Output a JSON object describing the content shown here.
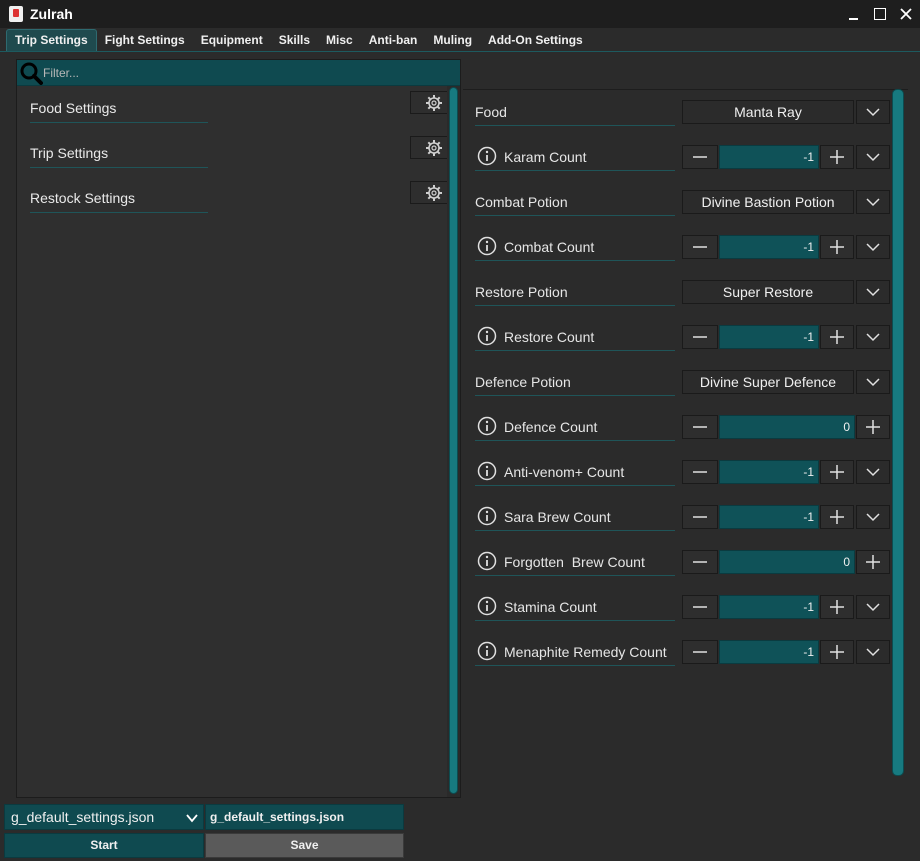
{
  "window": {
    "title": "Zulrah"
  },
  "tabs": [
    {
      "label": "Trip Settings",
      "active": true
    },
    {
      "label": "Fight Settings"
    },
    {
      "label": "Equipment"
    },
    {
      "label": "Skills"
    },
    {
      "label": "Misc"
    },
    {
      "label": "Anti-ban"
    },
    {
      "label": "Muling"
    },
    {
      "label": "Add-On Settings"
    }
  ],
  "left": {
    "filter_placeholder": "Filter...",
    "items": [
      {
        "label": "Food Settings",
        "icon": "gear-icon"
      },
      {
        "label": "Trip Settings",
        "icon": "gear-icon"
      },
      {
        "label": "Restock Settings",
        "icon": "gear-icon"
      }
    ]
  },
  "settings": [
    {
      "label": "Food",
      "type": "select",
      "value": "Manta Ray"
    },
    {
      "label": "Karam Count",
      "type": "spinner",
      "value": "-1",
      "info": true
    },
    {
      "label": "Combat Potion",
      "type": "select",
      "value": "Divine Bastion Potion"
    },
    {
      "label": "Combat Count",
      "type": "spinner",
      "value": "-1",
      "info": true
    },
    {
      "label": "Restore Potion",
      "type": "select",
      "value": "Super Restore"
    },
    {
      "label": "Restore Count",
      "type": "spinner",
      "value": "-1",
      "info": true
    },
    {
      "label": "Defence Potion",
      "type": "select",
      "value": "Divine Super Defence"
    },
    {
      "label": "Defence Count",
      "type": "number",
      "value": "0",
      "info": true
    },
    {
      "label": "Anti-venom+ Count",
      "type": "spinner",
      "value": "-1",
      "info": true
    },
    {
      "label": "Sara Brew Count",
      "type": "spinner",
      "value": "-1",
      "info": true
    },
    {
      "label": "Forgotten  Brew Count",
      "type": "number",
      "value": "0",
      "info": true
    },
    {
      "label": "Stamina Count",
      "type": "spinner",
      "value": "-1",
      "info": true
    },
    {
      "label": "Menaphite Remedy Count",
      "type": "spinner",
      "value": "-1",
      "info": true
    }
  ],
  "bottom": {
    "profile_select": "g_default_settings.json",
    "profile_name": "g_default_settings.json",
    "start_label": "Start",
    "save_label": "Save"
  },
  "colors": {
    "accent": "#0f4a50",
    "scrollbar": "#177a80",
    "background": "#2b2b2b"
  }
}
